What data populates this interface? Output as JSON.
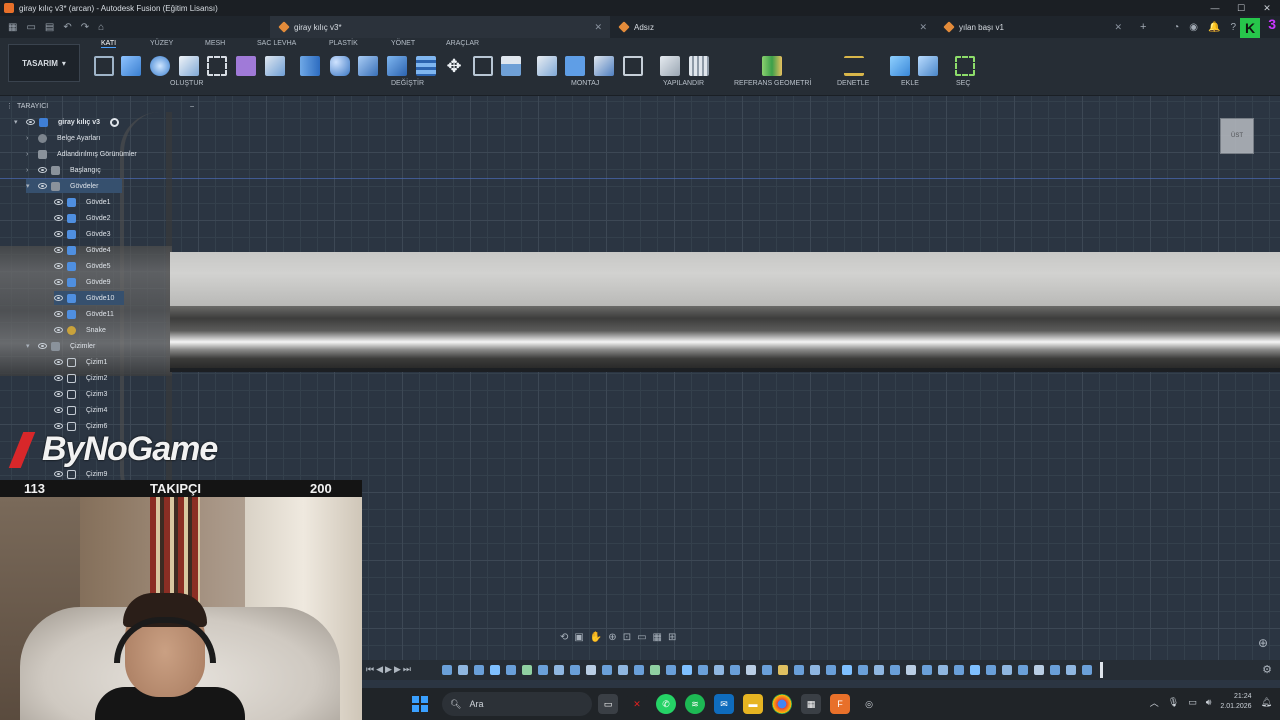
{
  "window": {
    "title": "giray kılıç v3* (arcan) - Autodesk Fusion (Eğitim Lisansı)",
    "controls": [
      "—",
      "☐",
      "✕"
    ]
  },
  "tabs": [
    {
      "label": "giray kılıç v3*",
      "active": true
    },
    {
      "label": "Adsız",
      "active": false
    },
    {
      "label": "yılan başı v1",
      "active": false
    }
  ],
  "badge": {
    "letter": "K",
    "count": "3"
  },
  "workspace": {
    "label": "TASARIM"
  },
  "ribbon_tabs": [
    "KATI",
    "YÜZEY",
    "MESH",
    "SAC LEVHA",
    "PLASTİK",
    "YÖNET",
    "ARAÇLAR"
  ],
  "tool_groups": [
    "OLUŞTUR",
    "DEĞİŞTİR",
    "MONTAJ",
    "YAPILANDIR",
    "REFERANS GEOMETRİ",
    "DENETLE",
    "EKLE",
    "SEÇ"
  ],
  "browser": {
    "title": "TARAYICI",
    "root": "giray kılıç v3",
    "items": [
      {
        "label": "Belge Ayarları",
        "icon": "gear-icon"
      },
      {
        "label": "Adlandırılmış Görünümler",
        "icon": "folder-icon"
      },
      {
        "label": "Başlangıç",
        "icon": "folder-icon"
      },
      {
        "label": "Gövdeler",
        "icon": "folder-icon"
      },
      {
        "label": "Gövde1",
        "icon": "body-icon"
      },
      {
        "label": "Gövde2",
        "icon": "body-icon"
      },
      {
        "label": "Gövde3",
        "icon": "body-icon"
      },
      {
        "label": "Gövde4",
        "icon": "body-icon"
      },
      {
        "label": "Gövde5",
        "icon": "body-icon"
      },
      {
        "label": "Gövde9",
        "icon": "body-icon"
      },
      {
        "label": "Gövde10",
        "icon": "body-icon"
      },
      {
        "label": "Gövde11",
        "icon": "body-icon"
      },
      {
        "label": "Snake",
        "icon": "snake-icon"
      },
      {
        "label": "Çizimler",
        "icon": "folder-icon"
      },
      {
        "label": "Çizim1",
        "icon": "sketch-icon"
      },
      {
        "label": "Çizim2",
        "icon": "sketch-icon"
      },
      {
        "label": "Çizim3",
        "icon": "sketch-icon"
      },
      {
        "label": "Çizim4",
        "icon": "sketch-icon"
      },
      {
        "label": "Çizim6",
        "icon": "sketch-icon"
      },
      {
        "label": "Çizim9",
        "icon": "sketch-icon"
      }
    ]
  },
  "viewcube": {
    "label": "ÜST"
  },
  "stream": {
    "logo": "ByNoGame",
    "followers_current": "113",
    "followers_label": "TAKIPÇI",
    "followers_goal": "200"
  },
  "taskbar": {
    "search_placeholder": "Ara",
    "time": "21:24",
    "date": "2.01.2026"
  },
  "colors": {
    "accent": "#4da3ff",
    "body_icon": "#4f8fe0",
    "logo_red": "#d8272a",
    "badge_green": "#27c64b"
  }
}
